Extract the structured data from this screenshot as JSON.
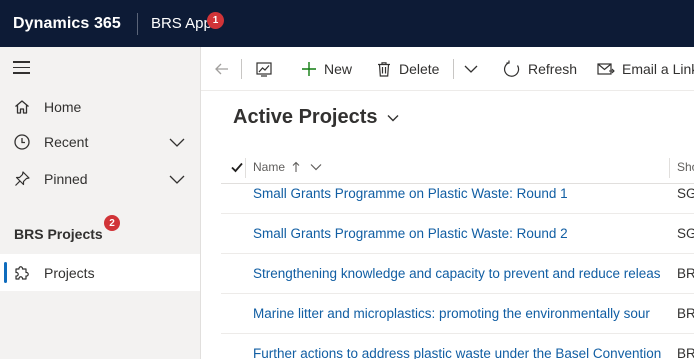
{
  "topbar": {
    "brand": "Dynamics 365",
    "app_name": "BRS App",
    "notification_count": "1"
  },
  "sidebar": {
    "items": [
      {
        "label": "Home",
        "icon": "home-icon"
      },
      {
        "label": "Recent",
        "icon": "clock-icon"
      },
      {
        "label": "Pinned",
        "icon": "pin-icon"
      }
    ],
    "group_title": "BRS Projects",
    "selected_item": {
      "label": "Projects",
      "icon": "puzzle-icon",
      "badge": "2"
    }
  },
  "commandbar": {
    "new_label": "New",
    "delete_label": "Delete",
    "refresh_label": "Refresh",
    "email_label": "Email a Link"
  },
  "view": {
    "title": "Active Projects",
    "columns": {
      "name": "Name",
      "short": "Sho"
    },
    "rows": [
      {
        "name": "Small Grants Programme on Plastic Waste: Round 1",
        "code": "SG"
      },
      {
        "name": "Small Grants Programme on Plastic Waste: Round 2",
        "code": "SG"
      },
      {
        "name": "Strengthening knowledge and capacity to prevent and reduce releas",
        "code": "BR"
      },
      {
        "name": "Marine litter and microplastics: promoting the environmentally sour",
        "code": "BR"
      },
      {
        "name": "Further actions to address plastic waste under the Basel Convention",
        "code": "BR"
      }
    ]
  },
  "colors": {
    "topbar": "#0d1b36",
    "accent": "#0f6cbd",
    "badge": "#d13438",
    "link": "#115ea3"
  }
}
